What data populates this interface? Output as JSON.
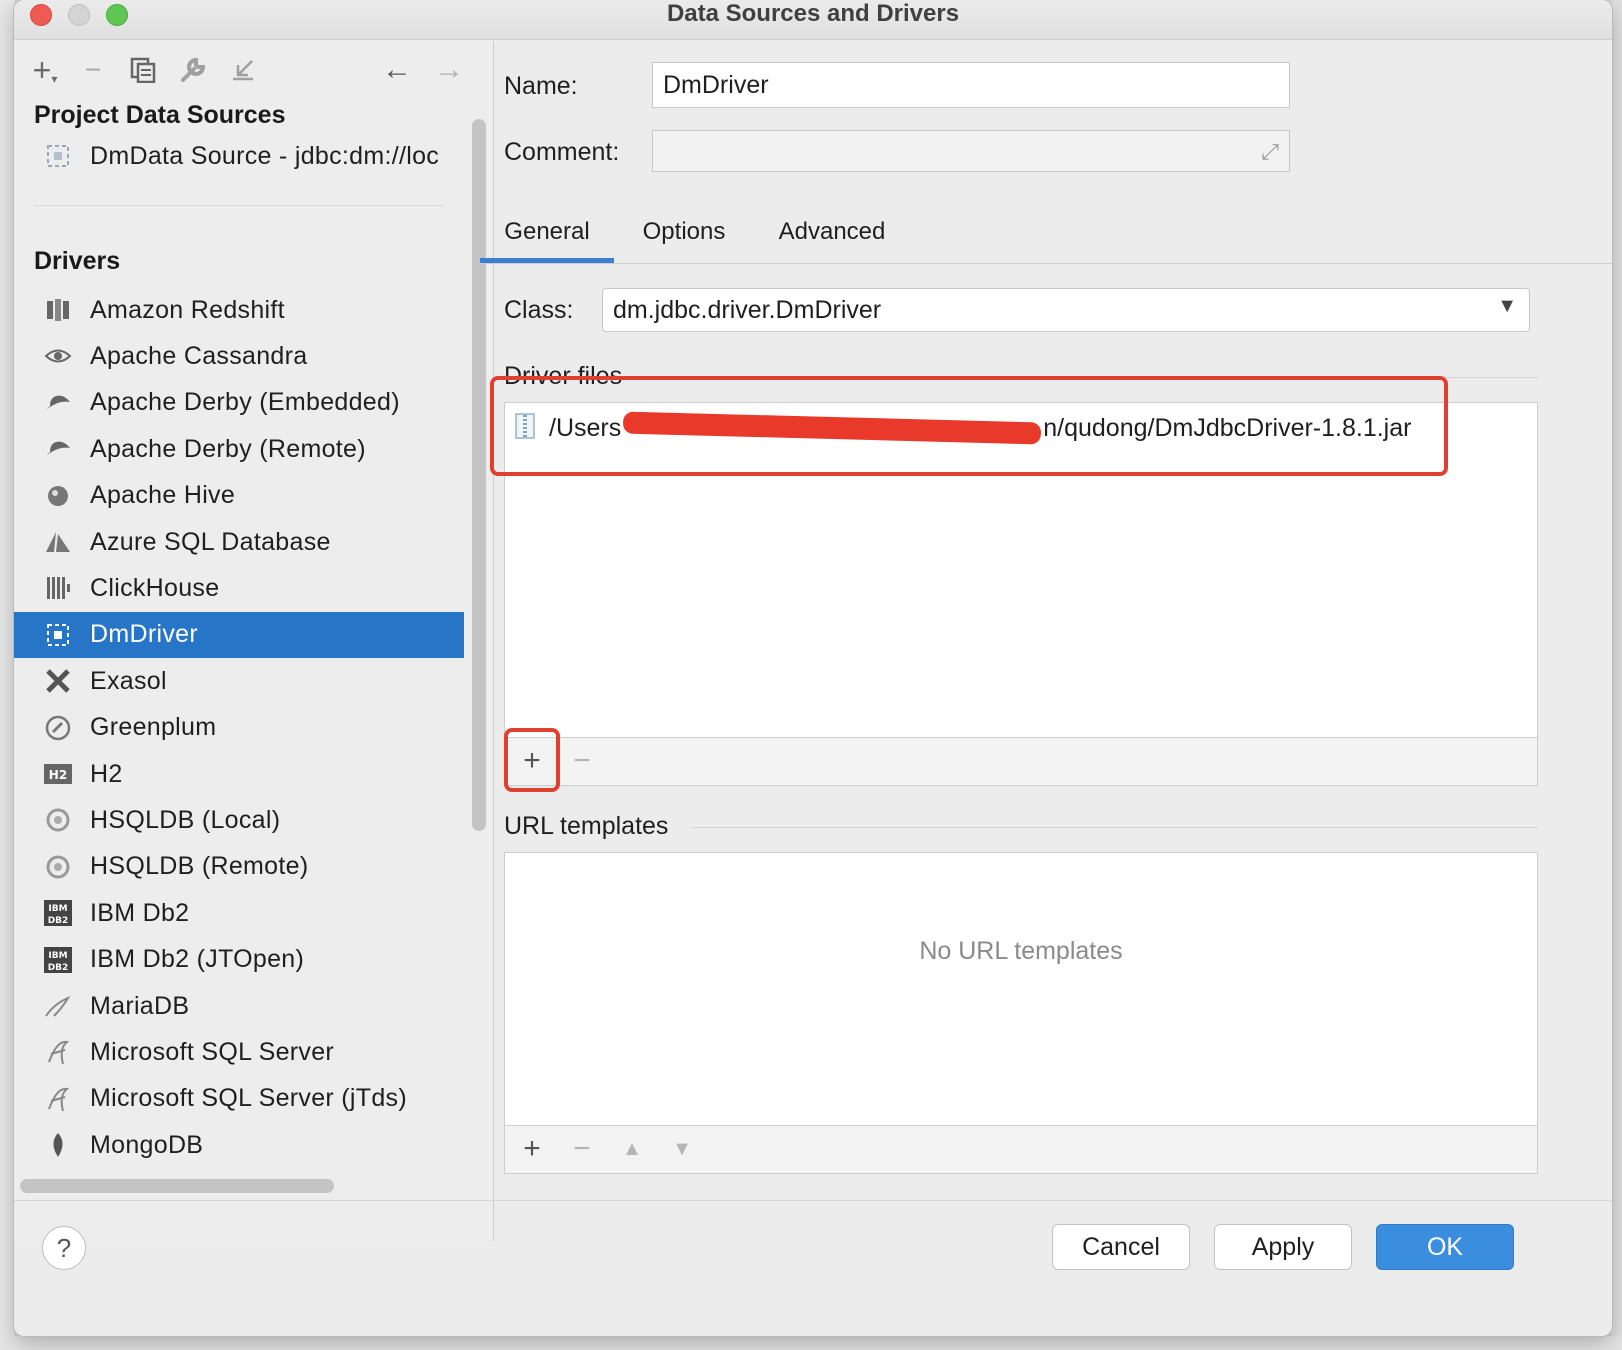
{
  "window": {
    "title": "Data Sources and Drivers"
  },
  "colors": {
    "accent": "#2675c6",
    "ok_button": "#3b8ede",
    "annotation_red": "#e0402f"
  },
  "toolbar": {
    "icons": [
      "add-icon",
      "remove-icon",
      "duplicate-icon",
      "wrench-icon",
      "import-icon",
      "back-arrow-icon",
      "forward-arrow-icon"
    ]
  },
  "sidebar": {
    "project_section_title": "Project Data Sources",
    "project_sources": [
      {
        "label": "DmData Source - jdbc:dm://loc",
        "icon": "dm-icon"
      }
    ],
    "drivers_section_title": "Drivers",
    "drivers": [
      {
        "label": "Amazon Redshift",
        "icon": "redshift-icon"
      },
      {
        "label": "Apache Cassandra",
        "icon": "cassandra-eye-icon"
      },
      {
        "label": "Apache Derby (Embedded)",
        "icon": "derby-hat-icon"
      },
      {
        "label": "Apache Derby (Remote)",
        "icon": "derby-hat-icon"
      },
      {
        "label": "Apache Hive",
        "icon": "hive-icon"
      },
      {
        "label": "Azure SQL Database",
        "icon": "azure-icon"
      },
      {
        "label": "ClickHouse",
        "icon": "clickhouse-icon"
      },
      {
        "label": "DmDriver",
        "icon": "dm-icon",
        "selected": true
      },
      {
        "label": "Exasol",
        "icon": "exasol-x-icon"
      },
      {
        "label": "Greenplum",
        "icon": "greenplum-icon"
      },
      {
        "label": "H2",
        "icon": "h2-icon"
      },
      {
        "label": "HSQLDB (Local)",
        "icon": "hsqldb-icon"
      },
      {
        "label": "HSQLDB (Remote)",
        "icon": "hsqldb-icon"
      },
      {
        "label": "IBM Db2",
        "icon": "ibm-db2-icon"
      },
      {
        "label": "IBM Db2 (JTOpen)",
        "icon": "ibm-db2-icon"
      },
      {
        "label": "MariaDB",
        "icon": "mariadb-seal-icon"
      },
      {
        "label": "Microsoft SQL Server",
        "icon": "sqlserver-icon"
      },
      {
        "label": "Microsoft SQL Server (jTds)",
        "icon": "sqlserver-icon"
      },
      {
        "label": "MongoDB",
        "icon": "mongodb-leaf-icon"
      }
    ]
  },
  "form": {
    "name_label": "Name:",
    "name_value": "DmDriver",
    "comment_label": "Comment:",
    "comment_value": "",
    "tabs": [
      "General",
      "Options",
      "Advanced"
    ],
    "active_tab": "General",
    "class_label": "Class:",
    "class_value": "dm.jdbc.driver.DmDriver",
    "driver_files_title": "Driver files",
    "driver_files": [
      {
        "path_start": "/Users",
        "path_end": "n/qudong/DmJdbcDriver-1.8.1.jar",
        "icon": "jar-file-icon"
      }
    ],
    "url_templates_title": "URL templates",
    "url_templates_empty": "No URL templates"
  },
  "footer": {
    "help_label": "?",
    "cancel_label": "Cancel",
    "apply_label": "Apply",
    "ok_label": "OK"
  }
}
